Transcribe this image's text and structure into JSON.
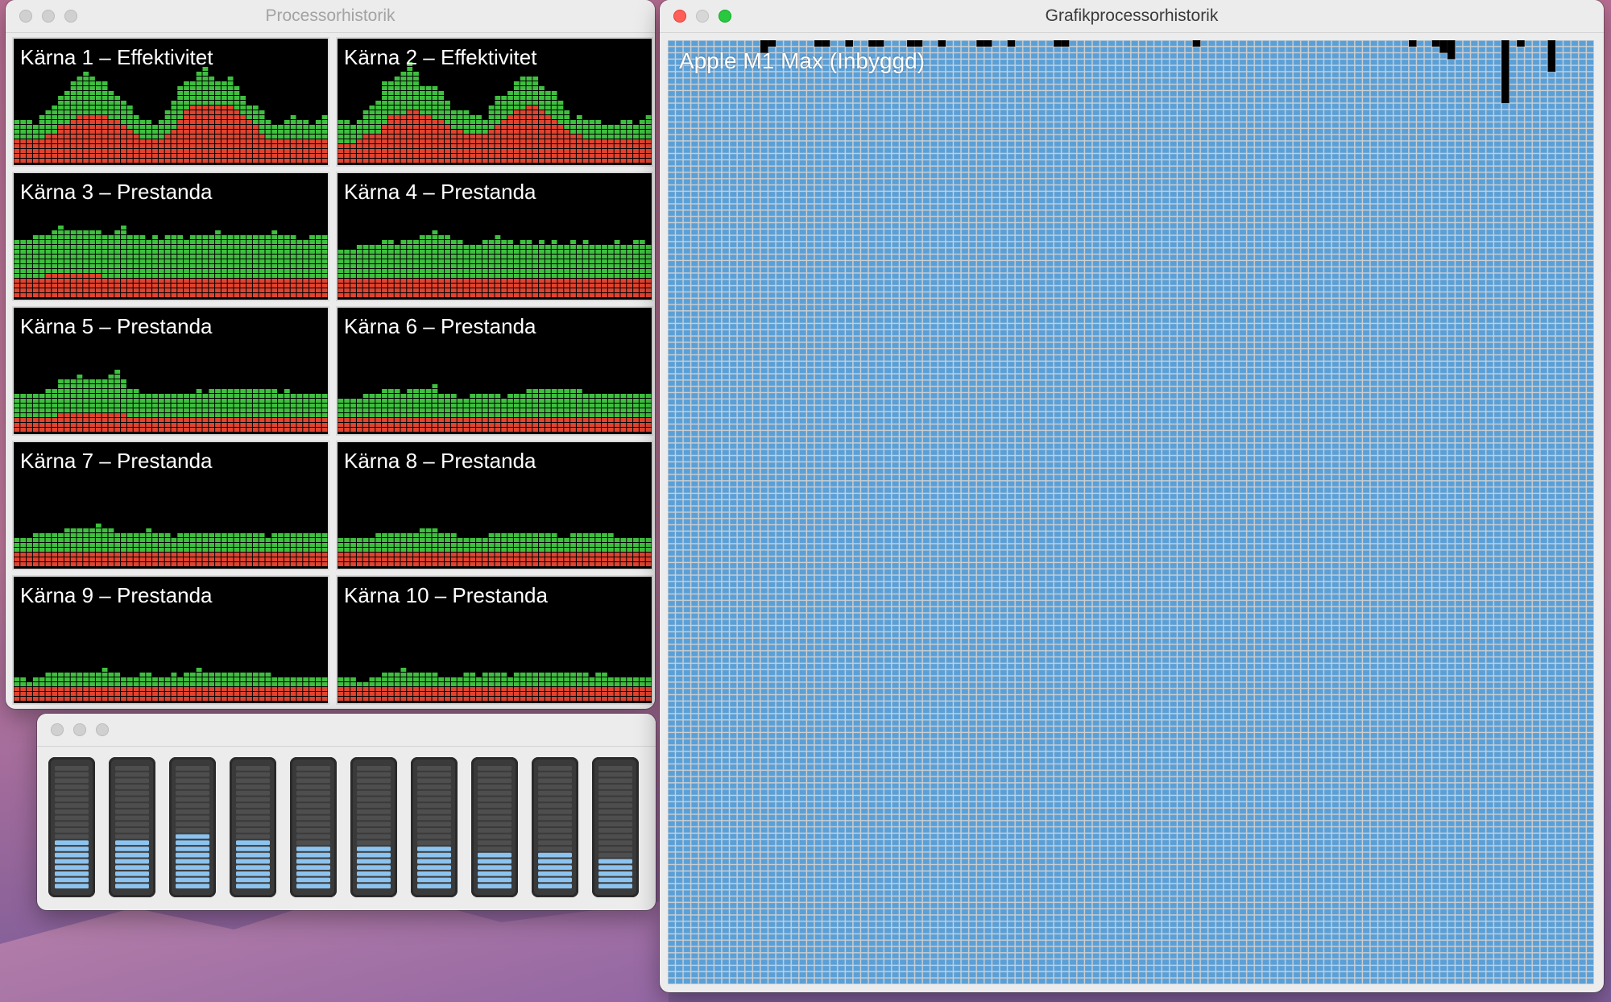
{
  "cpu_window": {
    "title": "Processorhistorik",
    "cores": [
      {
        "label": "Kärna 1 – Effektivitet",
        "user": [
          5,
          5,
          5,
          5,
          5,
          6,
          6,
          8,
          8,
          9,
          10,
          10,
          10,
          10,
          10,
          9,
          9,
          8,
          7,
          6,
          5,
          5,
          5,
          5,
          6,
          7,
          9,
          11,
          12,
          12,
          12,
          12,
          12,
          12,
          12,
          11,
          10,
          9,
          8,
          6,
          5,
          5,
          5,
          5,
          5,
          5,
          5,
          5,
          5,
          5
        ],
        "system": [
          4,
          4,
          4,
          3,
          5,
          5,
          6,
          6,
          7,
          8,
          8,
          9,
          8,
          7,
          7,
          6,
          5,
          5,
          5,
          4,
          4,
          4,
          3,
          4,
          5,
          6,
          7,
          6,
          5,
          7,
          8,
          6,
          5,
          5,
          6,
          5,
          4,
          3,
          4,
          5,
          4,
          3,
          3,
          4,
          5,
          4,
          4,
          3,
          4,
          5
        ]
      },
      {
        "label": "Kärna 2 – Effektivitet",
        "user": [
          4,
          4,
          4,
          5,
          6,
          6,
          6,
          8,
          10,
          10,
          10,
          11,
          11,
          10,
          10,
          9,
          9,
          8,
          7,
          7,
          6,
          6,
          6,
          6,
          7,
          8,
          9,
          10,
          11,
          11,
          12,
          12,
          11,
          10,
          9,
          8,
          7,
          6,
          6,
          5,
          5,
          5,
          5,
          5,
          5,
          5,
          5,
          5,
          5,
          5
        ],
        "system": [
          5,
          5,
          4,
          4,
          5,
          6,
          7,
          9,
          7,
          8,
          9,
          10,
          8,
          6,
          6,
          7,
          6,
          5,
          4,
          4,
          5,
          4,
          4,
          3,
          5,
          6,
          5,
          5,
          6,
          7,
          6,
          6,
          5,
          5,
          6,
          5,
          4,
          3,
          4,
          4,
          4,
          4,
          3,
          3,
          3,
          4,
          4,
          3,
          4,
          5
        ]
      },
      {
        "label": "Kärna 3 – Prestanda",
        "user": [
          4,
          4,
          4,
          4,
          4,
          5,
          5,
          5,
          5,
          5,
          5,
          5,
          5,
          5,
          4,
          4,
          4,
          4,
          4,
          4,
          4,
          4,
          4,
          4,
          4,
          4,
          4,
          4,
          4,
          4,
          4,
          4,
          4,
          4,
          4,
          4,
          4,
          4,
          4,
          4,
          4,
          4,
          4,
          4,
          4,
          4,
          4,
          4,
          4,
          4
        ],
        "system": [
          8,
          8,
          8,
          9,
          9,
          8,
          9,
          10,
          9,
          9,
          9,
          9,
          9,
          9,
          9,
          9,
          10,
          11,
          9,
          9,
          9,
          8,
          9,
          8,
          9,
          9,
          9,
          8,
          9,
          9,
          9,
          9,
          10,
          9,
          9,
          9,
          9,
          9,
          9,
          9,
          9,
          10,
          9,
          9,
          9,
          8,
          8,
          9,
          9,
          9
        ]
      },
      {
        "label": "Kärna 4 – Prestanda",
        "user": [
          4,
          4,
          4,
          4,
          4,
          4,
          4,
          4,
          4,
          4,
          4,
          4,
          4,
          4,
          4,
          4,
          4,
          4,
          4,
          4,
          4,
          4,
          4,
          4,
          4,
          4,
          4,
          4,
          4,
          4,
          4,
          4,
          4,
          4,
          4,
          4,
          4,
          4,
          4,
          4,
          4,
          4,
          4,
          4,
          4,
          4,
          4,
          4,
          4,
          4
        ],
        "system": [
          6,
          6,
          6,
          7,
          7,
          7,
          7,
          8,
          8,
          7,
          8,
          8,
          8,
          9,
          9,
          10,
          9,
          9,
          8,
          8,
          7,
          7,
          7,
          8,
          8,
          9,
          8,
          8,
          7,
          8,
          8,
          7,
          8,
          7,
          8,
          7,
          7,
          8,
          7,
          8,
          7,
          7,
          7,
          7,
          8,
          7,
          7,
          8,
          8,
          7
        ]
      },
      {
        "label": "Kärna 5 – Prestanda",
        "user": [
          3,
          3,
          3,
          3,
          3,
          3,
          3,
          4,
          4,
          4,
          4,
          4,
          4,
          4,
          4,
          4,
          4,
          4,
          3,
          3,
          3,
          3,
          3,
          3,
          3,
          3,
          3,
          3,
          3,
          3,
          3,
          3,
          3,
          3,
          3,
          3,
          3,
          3,
          3,
          3,
          3,
          3,
          3,
          3,
          3,
          3,
          3,
          3,
          3,
          3
        ],
        "system": [
          5,
          5,
          5,
          5,
          5,
          6,
          6,
          7,
          7,
          7,
          8,
          7,
          7,
          7,
          7,
          8,
          9,
          7,
          6,
          6,
          5,
          5,
          5,
          5,
          5,
          5,
          5,
          5,
          5,
          6,
          5,
          6,
          6,
          6,
          6,
          6,
          6,
          6,
          6,
          6,
          6,
          6,
          5,
          6,
          5,
          5,
          5,
          5,
          5,
          5
        ]
      },
      {
        "label": "Kärna 6 – Prestanda",
        "user": [
          3,
          3,
          3,
          3,
          3,
          3,
          3,
          3,
          3,
          3,
          3,
          3,
          3,
          3,
          3,
          3,
          3,
          3,
          3,
          3,
          3,
          3,
          3,
          3,
          3,
          3,
          3,
          3,
          3,
          3,
          3,
          3,
          3,
          3,
          3,
          3,
          3,
          3,
          3,
          3,
          3,
          3,
          3,
          3,
          3,
          3,
          3,
          3,
          3,
          3
        ],
        "system": [
          4,
          4,
          4,
          4,
          5,
          5,
          5,
          6,
          6,
          6,
          5,
          6,
          6,
          6,
          6,
          7,
          5,
          5,
          5,
          4,
          4,
          5,
          5,
          5,
          5,
          5,
          4,
          5,
          5,
          5,
          6,
          6,
          6,
          6,
          6,
          6,
          6,
          6,
          6,
          5,
          5,
          5,
          5,
          5,
          5,
          5,
          5,
          5,
          5,
          5
        ]
      },
      {
        "label": "Kärna 7 – Prestanda",
        "user": [
          3,
          3,
          3,
          3,
          3,
          3,
          3,
          3,
          3,
          3,
          3,
          3,
          3,
          3,
          3,
          3,
          3,
          3,
          3,
          3,
          3,
          3,
          3,
          3,
          3,
          3,
          3,
          3,
          3,
          3,
          3,
          3,
          3,
          3,
          3,
          3,
          3,
          3,
          3,
          3,
          3,
          3,
          3,
          3,
          3,
          3,
          3,
          3,
          3,
          3
        ],
        "system": [
          3,
          3,
          3,
          4,
          4,
          4,
          4,
          4,
          5,
          5,
          5,
          5,
          5,
          6,
          5,
          5,
          4,
          4,
          4,
          4,
          4,
          5,
          4,
          4,
          4,
          3,
          4,
          4,
          4,
          4,
          4,
          4,
          4,
          4,
          4,
          4,
          4,
          4,
          4,
          4,
          3,
          4,
          4,
          4,
          4,
          4,
          4,
          4,
          4,
          4
        ]
      },
      {
        "label": "Kärna 8 – Prestanda",
        "user": [
          3,
          3,
          3,
          3,
          3,
          3,
          3,
          3,
          3,
          3,
          3,
          3,
          3,
          3,
          3,
          3,
          3,
          3,
          3,
          3,
          3,
          3,
          3,
          3,
          3,
          3,
          3,
          3,
          3,
          3,
          3,
          3,
          3,
          3,
          3,
          3,
          3,
          3,
          3,
          3,
          3,
          3,
          3,
          3,
          3,
          3,
          3,
          3,
          3,
          3
        ],
        "system": [
          3,
          3,
          3,
          3,
          3,
          3,
          4,
          4,
          4,
          4,
          4,
          4,
          4,
          5,
          5,
          5,
          4,
          4,
          4,
          3,
          3,
          3,
          3,
          3,
          4,
          4,
          4,
          4,
          4,
          4,
          4,
          4,
          4,
          4,
          4,
          3,
          3,
          4,
          4,
          4,
          4,
          4,
          4,
          4,
          3,
          3,
          3,
          3,
          3,
          3
        ]
      },
      {
        "label": "Kärna 9 – Prestanda",
        "user": [
          3,
          3,
          3,
          3,
          3,
          3,
          3,
          3,
          3,
          3,
          3,
          3,
          3,
          3,
          3,
          3,
          3,
          3,
          3,
          3,
          3,
          3,
          3,
          3,
          3,
          3,
          3,
          3,
          3,
          3,
          3,
          3,
          3,
          3,
          3,
          3,
          3,
          3,
          3,
          3,
          3,
          3,
          3,
          3,
          3,
          3,
          3,
          3,
          3,
          3
        ],
        "system": [
          2,
          2,
          1,
          2,
          2,
          3,
          3,
          3,
          3,
          3,
          3,
          3,
          3,
          3,
          4,
          3,
          3,
          2,
          2,
          2,
          3,
          3,
          2,
          2,
          2,
          3,
          2,
          3,
          3,
          4,
          3,
          3,
          3,
          3,
          3,
          3,
          3,
          3,
          3,
          3,
          3,
          2,
          2,
          2,
          2,
          2,
          2,
          2,
          2,
          2
        ]
      },
      {
        "label": "Kärna 10 – Prestanda",
        "user": [
          3,
          3,
          3,
          3,
          3,
          3,
          3,
          3,
          3,
          3,
          3,
          3,
          3,
          3,
          3,
          3,
          3,
          3,
          3,
          3,
          3,
          3,
          3,
          3,
          3,
          3,
          3,
          3,
          3,
          3,
          3,
          3,
          3,
          3,
          3,
          3,
          3,
          3,
          3,
          3,
          3,
          3,
          3,
          3,
          3,
          3,
          3,
          3,
          3,
          3
        ],
        "system": [
          2,
          2,
          2,
          1,
          1,
          2,
          2,
          3,
          3,
          3,
          4,
          3,
          3,
          3,
          3,
          3,
          2,
          2,
          2,
          2,
          3,
          3,
          2,
          3,
          3,
          3,
          3,
          2,
          3,
          3,
          3,
          3,
          3,
          3,
          3,
          3,
          3,
          3,
          3,
          3,
          2,
          3,
          3,
          2,
          2,
          2,
          2,
          2,
          2,
          2
        ]
      }
    ],
    "colors": {
      "user": "#3fbf3f",
      "system": "#e0432f",
      "background": "#000000"
    }
  },
  "meter_window": {
    "levels": [
      0.42,
      0.42,
      0.46,
      0.42,
      0.34,
      0.34,
      0.34,
      0.3,
      0.3,
      0.24
    ],
    "colors": {
      "lit": "#8cc3ef",
      "unlit": "#4e4e4e"
    }
  },
  "gpu_window": {
    "title": "Grafikprocessorhistorik",
    "gpu_label": "Apple M1 Max (Inbyggd)",
    "idle_color": "#5aa0d8",
    "activity_columns": [
      {
        "col": 12,
        "blocks": 2
      },
      {
        "col": 13,
        "blocks": 1
      },
      {
        "col": 19,
        "blocks": 1
      },
      {
        "col": 20,
        "blocks": 1
      },
      {
        "col": 23,
        "blocks": 1
      },
      {
        "col": 26,
        "blocks": 1
      },
      {
        "col": 27,
        "blocks": 1
      },
      {
        "col": 31,
        "blocks": 1
      },
      {
        "col": 32,
        "blocks": 1
      },
      {
        "col": 35,
        "blocks": 1
      },
      {
        "col": 40,
        "blocks": 1
      },
      {
        "col": 41,
        "blocks": 1
      },
      {
        "col": 44,
        "blocks": 1
      },
      {
        "col": 50,
        "blocks": 1
      },
      {
        "col": 51,
        "blocks": 1
      },
      {
        "col": 68,
        "blocks": 1
      },
      {
        "col": 96,
        "blocks": 1
      },
      {
        "col": 99,
        "blocks": 1
      },
      {
        "col": 100,
        "blocks": 2
      },
      {
        "col": 101,
        "blocks": 3
      },
      {
        "col": 108,
        "blocks": 10
      },
      {
        "col": 110,
        "blocks": 1
      },
      {
        "col": 114,
        "blocks": 5
      }
    ]
  }
}
